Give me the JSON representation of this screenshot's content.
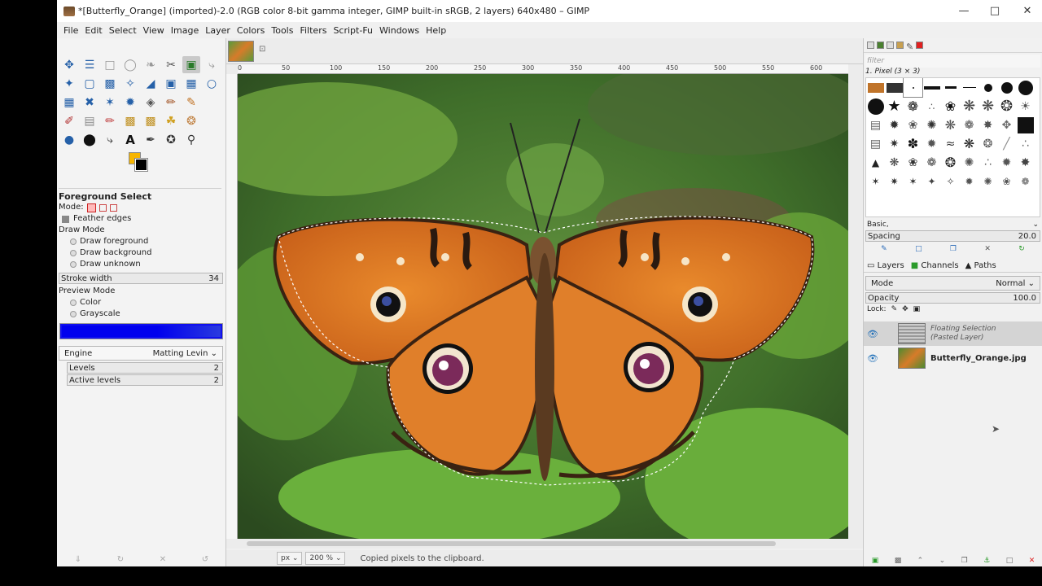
{
  "window": {
    "title": "*[Butterfly_Orange] (imported)-2.0 (RGB color 8-bit gamma integer, GIMP built-in sRGB, 2 layers) 640x480 – GIMP",
    "controls": [
      "minimize",
      "maximize",
      "close"
    ]
  },
  "menu": [
    "File",
    "Edit",
    "Select",
    "View",
    "Image",
    "Layer",
    "Colors",
    "Tools",
    "Filters",
    "Script-Fu",
    "Windows",
    "Help"
  ],
  "colors": {
    "foreground": "#f7b500",
    "background": "#000000",
    "preview": "#0000ee"
  },
  "tool_options": {
    "title": "Foreground Select",
    "mode_label": "Mode:",
    "feather_label": "Feather edges",
    "draw_mode_label": "Draw Mode",
    "draw_mode_options": [
      "Draw foreground",
      "Draw background",
      "Draw unknown"
    ],
    "stroke_label": "Stroke width",
    "stroke_value": "34",
    "preview_mode_label": "Preview Mode",
    "preview_options": [
      "Color",
      "Grayscale"
    ],
    "engine_label": "Engine",
    "engine_value": "Matting Levin",
    "levels_label": "Levels",
    "levels_value": "2",
    "active_levels_label": "Active levels",
    "active_levels_value": "2"
  },
  "rulers": {
    "h_labels": [
      "0",
      "50",
      "100",
      "150",
      "200",
      "250",
      "300",
      "350",
      "400",
      "450",
      "500",
      "550",
      "600"
    ]
  },
  "status": {
    "unit": "px",
    "zoom": "200 %",
    "message": "Copied pixels to the clipboard."
  },
  "brushes": {
    "filter_placeholder": "filter",
    "current": "1. Pixel (3 × 3)",
    "tag": "Basic,",
    "spacing_label": "Spacing",
    "spacing_value": "20.0"
  },
  "layers_panel": {
    "tabs": [
      "Layers",
      "Channels",
      "Paths"
    ],
    "mode_label": "Mode",
    "mode_value": "Normal",
    "opacity_label": "Opacity",
    "opacity_value": "100.0",
    "lock_label": "Lock:",
    "layers": [
      {
        "name": "Floating Selection",
        "sub": "(Pasted Layer)",
        "selected": true
      },
      {
        "name": "Butterfly_Orange.jpg",
        "sub": "",
        "selected": false
      }
    ]
  }
}
